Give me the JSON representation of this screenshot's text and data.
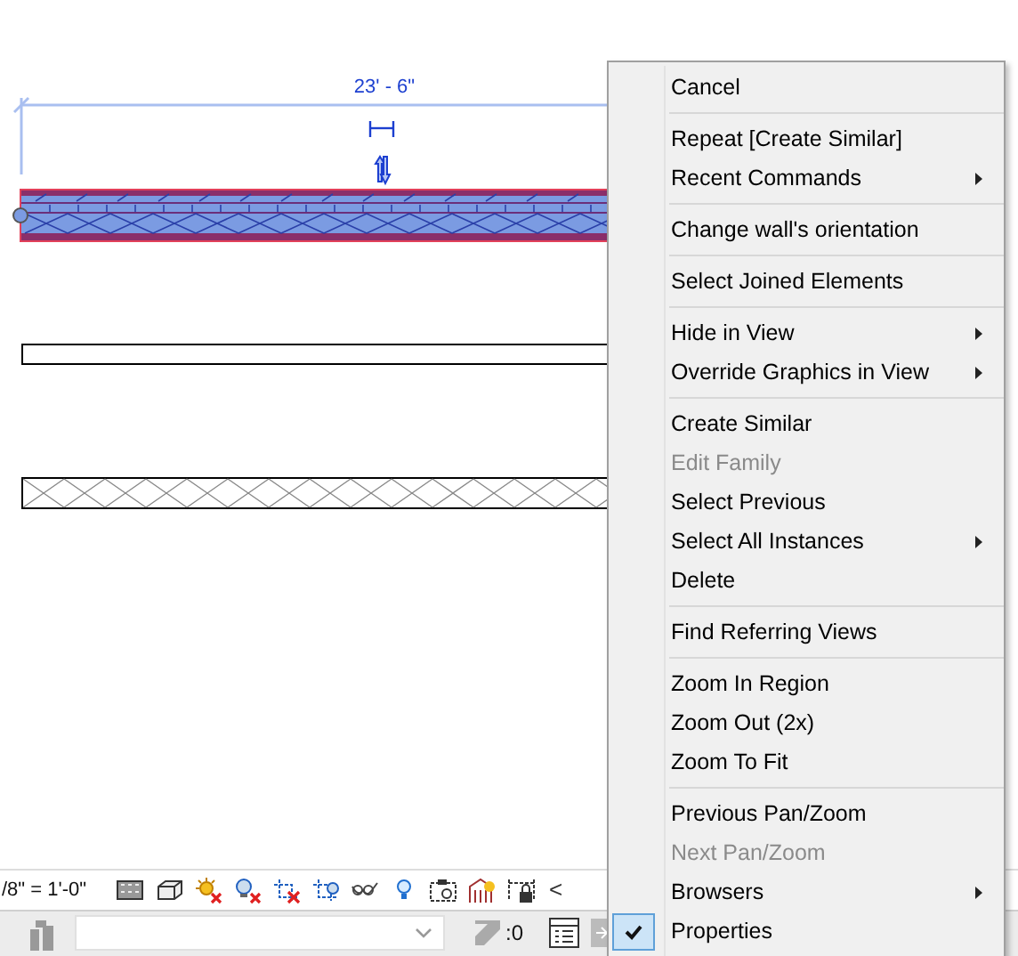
{
  "drawing": {
    "dimension": "23' - 6\""
  },
  "view_bar": {
    "scale": "/8\" = 1'-0\"",
    "collapse": "<"
  },
  "status_bar": {
    "selection_count": ":0"
  },
  "context_menu": {
    "groups": [
      {
        "items": [
          {
            "label": "Cancel",
            "disabled": false,
            "submenu": false,
            "checked": false
          }
        ]
      },
      {
        "items": [
          {
            "label": "Repeat [Create Similar]",
            "disabled": false,
            "submenu": false,
            "checked": false
          },
          {
            "label": "Recent Commands",
            "disabled": false,
            "submenu": true,
            "checked": false
          }
        ]
      },
      {
        "items": [
          {
            "label": "Change wall's orientation",
            "disabled": false,
            "submenu": false,
            "checked": false
          }
        ]
      },
      {
        "items": [
          {
            "label": "Select Joined Elements",
            "disabled": false,
            "submenu": false,
            "checked": false
          }
        ]
      },
      {
        "items": [
          {
            "label": "Hide in View",
            "disabled": false,
            "submenu": true,
            "checked": false
          },
          {
            "label": "Override Graphics in View",
            "disabled": false,
            "submenu": true,
            "checked": false
          }
        ]
      },
      {
        "items": [
          {
            "label": "Create Similar",
            "disabled": false,
            "submenu": false,
            "checked": false
          },
          {
            "label": "Edit Family",
            "disabled": true,
            "submenu": false,
            "checked": false
          },
          {
            "label": "Select Previous",
            "disabled": false,
            "submenu": false,
            "checked": false
          },
          {
            "label": "Select All Instances",
            "disabled": false,
            "submenu": true,
            "checked": false
          },
          {
            "label": "Delete",
            "disabled": false,
            "submenu": false,
            "checked": false
          }
        ]
      },
      {
        "items": [
          {
            "label": "Find Referring Views",
            "disabled": false,
            "submenu": false,
            "checked": false
          }
        ]
      },
      {
        "items": [
          {
            "label": "Zoom In Region",
            "disabled": false,
            "submenu": false,
            "checked": false
          },
          {
            "label": "Zoom Out (2x)",
            "disabled": false,
            "submenu": false,
            "checked": false
          },
          {
            "label": "Zoom To Fit",
            "disabled": false,
            "submenu": false,
            "checked": false
          }
        ]
      },
      {
        "items": [
          {
            "label": "Previous Pan/Zoom",
            "disabled": false,
            "submenu": false,
            "checked": false
          },
          {
            "label": "Next Pan/Zoom",
            "disabled": true,
            "submenu": false,
            "checked": false
          },
          {
            "label": "Browsers",
            "disabled": false,
            "submenu": true,
            "checked": false
          },
          {
            "label": "Properties",
            "disabled": false,
            "submenu": false,
            "checked": true
          }
        ]
      }
    ]
  }
}
